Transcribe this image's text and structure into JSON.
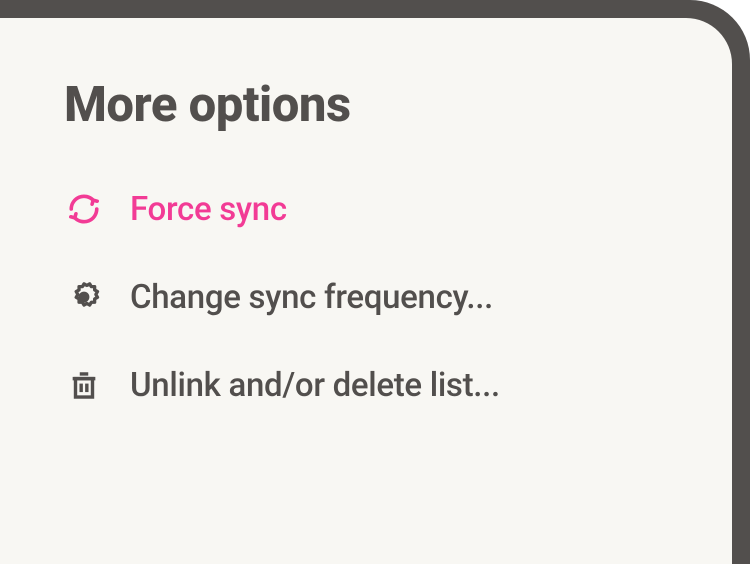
{
  "title": "More options",
  "options": [
    {
      "label": "Force sync",
      "icon": "sync-icon",
      "highlight": true
    },
    {
      "label": "Change sync frequency...",
      "icon": "gear-icon",
      "highlight": false
    },
    {
      "label": "Unlink and/or delete list...",
      "icon": "trash-icon",
      "highlight": false
    }
  ],
  "colors": {
    "accent": "#f23b95",
    "text": "#524f4d",
    "panel": "#f8f7f3",
    "frame": "#524f4d"
  }
}
